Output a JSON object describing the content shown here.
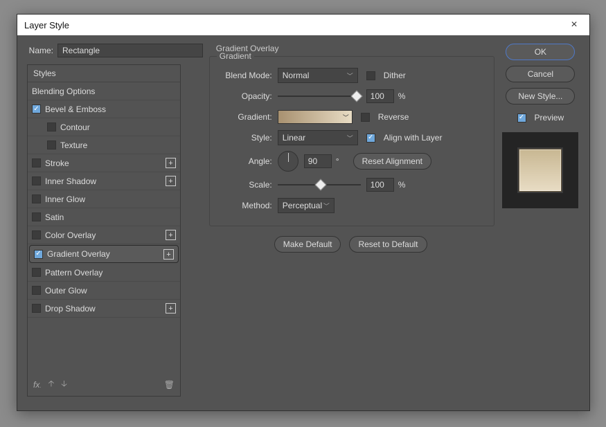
{
  "dialog": {
    "title": "Layer Style"
  },
  "name": {
    "label": "Name:",
    "value": "Rectangle"
  },
  "styles": {
    "header": "Styles",
    "items": [
      {
        "label": "Blending Options",
        "check": null
      },
      {
        "label": "Bevel & Emboss",
        "check": true
      },
      {
        "label": "Contour",
        "check": false,
        "indent": true
      },
      {
        "label": "Texture",
        "check": false,
        "indent": true
      },
      {
        "label": "Stroke",
        "check": false,
        "plus": true
      },
      {
        "label": "Inner Shadow",
        "check": false,
        "plus": true
      },
      {
        "label": "Inner Glow",
        "check": false
      },
      {
        "label": "Satin",
        "check": false
      },
      {
        "label": "Color Overlay",
        "check": false,
        "plus": true
      },
      {
        "label": "Gradient Overlay",
        "check": true,
        "plus": true,
        "selected": true
      },
      {
        "label": "Pattern Overlay",
        "check": false
      },
      {
        "label": "Outer Glow",
        "check": false
      },
      {
        "label": "Drop Shadow",
        "check": false,
        "plus": true
      }
    ]
  },
  "overlay": {
    "title": "Gradient Overlay",
    "group": "Gradient",
    "blend_mode": {
      "label": "Blend Mode:",
      "value": "Normal"
    },
    "dither": {
      "label": "Dither",
      "checked": false
    },
    "opacity": {
      "label": "Opacity:",
      "value": "100",
      "unit": "%",
      "pos": 100
    },
    "gradient": {
      "label": "Gradient:"
    },
    "reverse": {
      "label": "Reverse",
      "checked": false
    },
    "style": {
      "label": "Style:",
      "value": "Linear"
    },
    "align": {
      "label": "Align with Layer",
      "checked": true
    },
    "angle": {
      "label": "Angle:",
      "value": "90",
      "unit": "°"
    },
    "reset_align": "Reset Alignment",
    "scale": {
      "label": "Scale:",
      "value": "100",
      "unit": "%",
      "pos": 50
    },
    "method": {
      "label": "Method:",
      "value": "Perceptual"
    },
    "make_default": "Make Default",
    "reset_default": "Reset to Default"
  },
  "buttons": {
    "ok": "OK",
    "cancel": "Cancel",
    "new_style": "New Style..."
  },
  "preview": {
    "label": "Preview",
    "checked": true
  }
}
